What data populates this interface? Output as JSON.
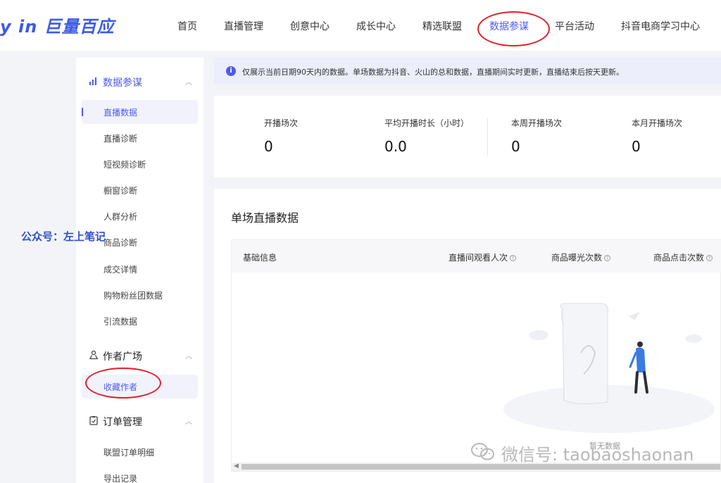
{
  "topnav": {
    "logo": "y in 巨量百应",
    "items": [
      {
        "label": "首页"
      },
      {
        "label": "直播管理"
      },
      {
        "label": "创意中心"
      },
      {
        "label": "成长中心"
      },
      {
        "label": "精选联盟"
      },
      {
        "label": "数据参谋",
        "active": true
      },
      {
        "label": "平台活动"
      },
      {
        "label": "抖音电商学习中心"
      }
    ]
  },
  "sidebar": {
    "groups": [
      {
        "label": "数据参谋",
        "icon": "chart-icon",
        "items": [
          "直播数据",
          "直播诊断",
          "短视频诊断",
          "橱窗诊断",
          "人群分析",
          "商品诊断",
          "成交详情",
          "购物粉丝团数据",
          "引流数据"
        ]
      },
      {
        "label": "作者广场",
        "icon": "users-icon",
        "items": [
          "收藏作者"
        ]
      },
      {
        "label": "订单管理",
        "icon": "clipboard-icon",
        "items": [
          "联盟订单明细",
          "导出记录"
        ]
      }
    ]
  },
  "watermark_left": "公众号：左上笔记",
  "notice": {
    "text": "仅展示当前日期90天内的数据。单场数据为抖音、火山的总和数据，直播期间实时更新，直播结束后按天更新。"
  },
  "stats": [
    {
      "label": "开播场次",
      "value": "0"
    },
    {
      "label": "平均开播时长（小时）",
      "value": "0.0"
    },
    {
      "label": "本周开播场次",
      "value": "0"
    },
    {
      "label": "本月开播场次",
      "value": "0"
    }
  ],
  "panel": {
    "title": "单场直播数据",
    "columns": [
      "基础信息",
      "直播间观看人次",
      "商品曝光次数",
      "商品点击次数"
    ],
    "empty_text": "暂无数据"
  },
  "watermark_bottom": "微信号: taobaoshaonan",
  "colors": {
    "accent": "#4e5bf2",
    "annotation": "#e0202a"
  }
}
